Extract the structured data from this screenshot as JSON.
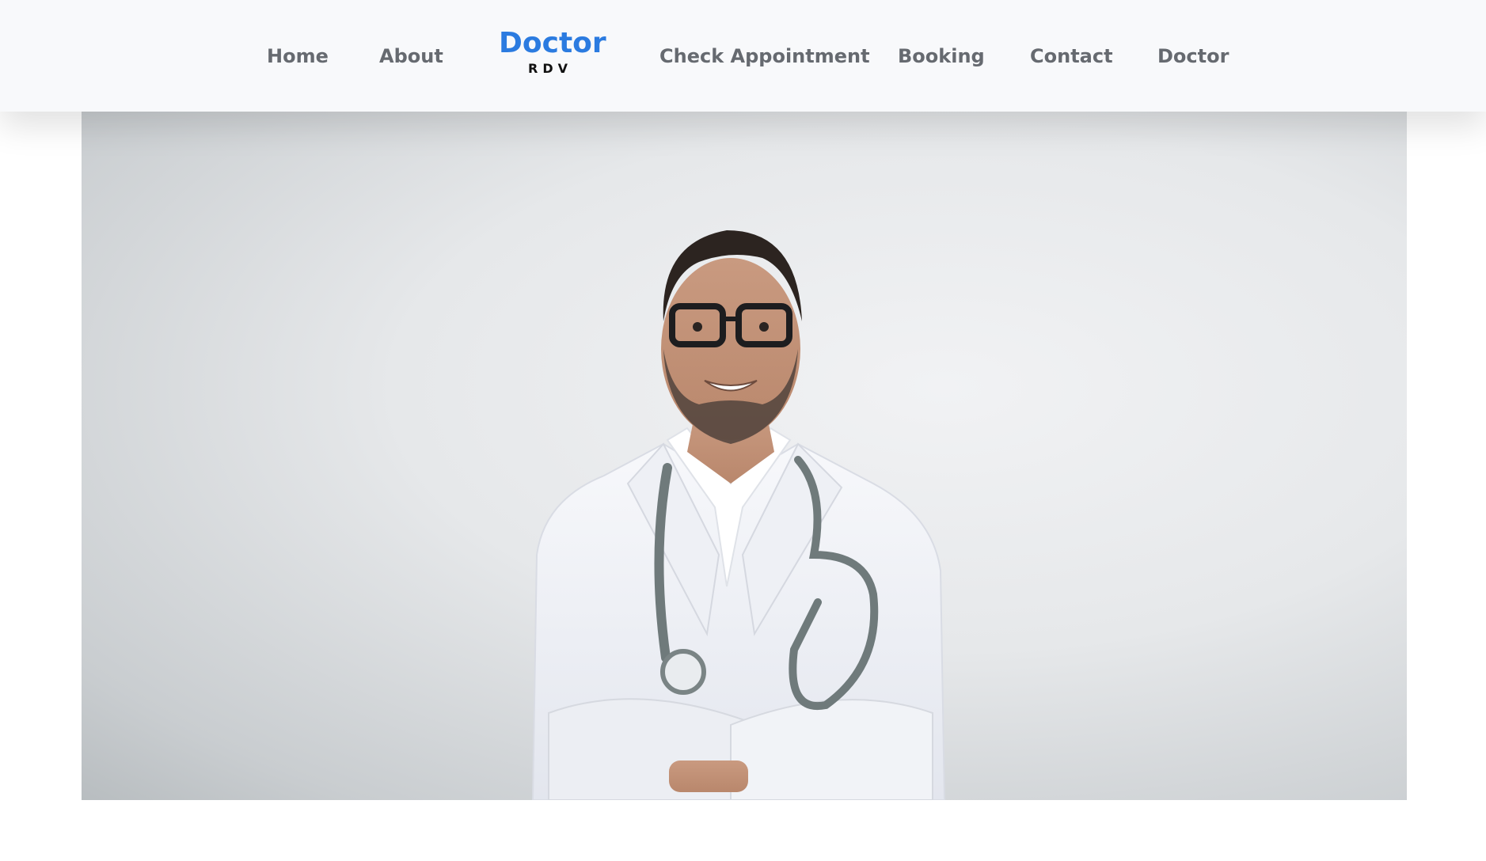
{
  "nav": {
    "left_links": [
      "Home",
      "About"
    ],
    "brand": {
      "title": "Doctor",
      "subtitle": "RDV"
    },
    "right_links": [
      "Check Appointment",
      "Booking",
      "Contact",
      "Doctor"
    ]
  },
  "colors": {
    "brand_blue": "#2b7be0",
    "nav_text": "#666a70",
    "navbar_bg": "#f8f9fb"
  },
  "hero": {
    "image": "doctor-portrait"
  }
}
